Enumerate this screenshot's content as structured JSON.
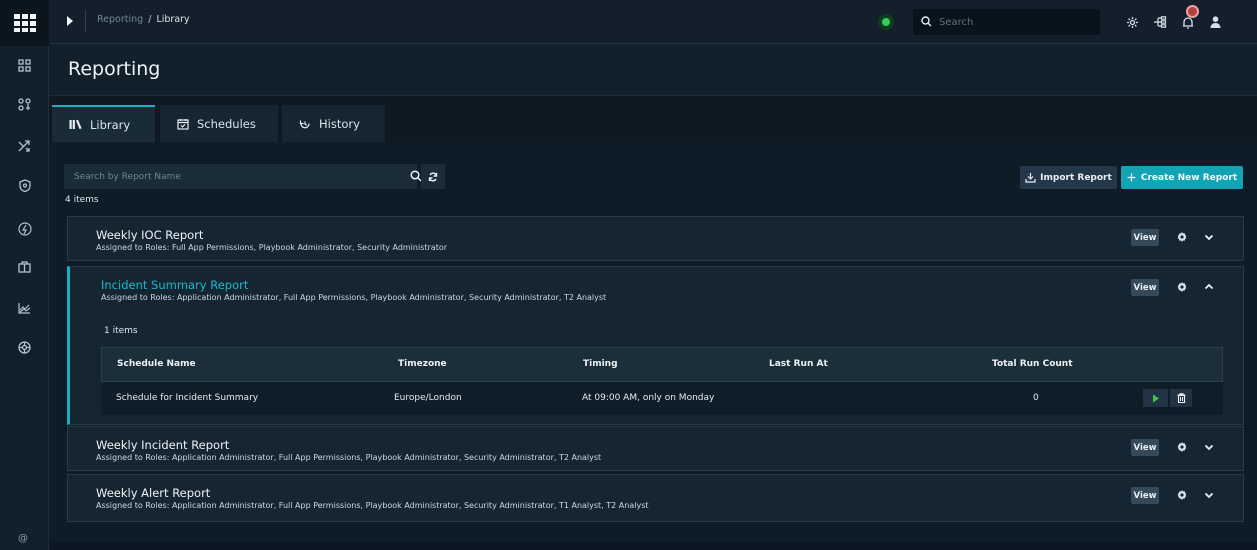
{
  "breadcrumb": {
    "parent": "Reporting",
    "separator": "/",
    "current": "Library"
  },
  "top_search": {
    "placeholder": "Search"
  },
  "page": {
    "title": "Reporting"
  },
  "tabs": [
    {
      "label": "Library",
      "icon": "library-icon",
      "active": true
    },
    {
      "label": "Schedules",
      "icon": "calendar-icon",
      "active": false
    },
    {
      "label": "History",
      "icon": "history-icon",
      "active": false
    }
  ],
  "toolbar": {
    "search_placeholder": "Search by Report Name",
    "items_count": "4 items",
    "import_label": "Import Report",
    "create_label": "Create New Report"
  },
  "reports": [
    {
      "title": "Weekly IOC Report",
      "roles": "Assigned to Roles: Full App Permissions, Playbook Administrator, Security Administrator",
      "view_label": "View",
      "expanded": false
    },
    {
      "title": "Incident Summary Report",
      "roles": "Assigned to Roles: Application Administrator, Full App Permissions, Playbook Administrator, Security Administrator, T2 Analyst",
      "view_label": "View",
      "expanded": true,
      "schedule_count": "1 items",
      "schedule_columns": [
        "Schedule Name",
        "Timezone",
        "Timing",
        "Last Run At",
        "Total Run Count"
      ],
      "schedule_rows": [
        {
          "name": "Schedule for Incident Summary",
          "timezone": "Europe/London",
          "timing": "At 09:00 AM, only on Monday",
          "last_run": "",
          "run_count": "0"
        }
      ]
    },
    {
      "title": "Weekly Incident Report",
      "roles": "Assigned to Roles: Application Administrator, Full App Permissions, Playbook Administrator, Security Administrator, T2 Analyst",
      "view_label": "View",
      "expanded": false
    },
    {
      "title": "Weekly Alert Report",
      "roles": "Assigned to Roles: Application Administrator, Full App Permissions, Playbook Administrator, Security Administrator, T1 Analyst, T2 Analyst",
      "view_label": "View",
      "expanded": false
    }
  ],
  "colors": {
    "accent": "#15b0bd",
    "status_online": "#31d158",
    "run_green": "#2fcf4d",
    "notification": "#b3403e"
  },
  "icons": {
    "sidebar": [
      "dashboard-icon",
      "connectors-icon",
      "shuffle-icon",
      "shield-icon",
      "bolt-icon",
      "briefcase-icon",
      "chart-icon",
      "settings-wheel-icon"
    ],
    "topbar": [
      "settings-icon",
      "tree-icon",
      "bell-icon",
      "user-icon"
    ]
  }
}
